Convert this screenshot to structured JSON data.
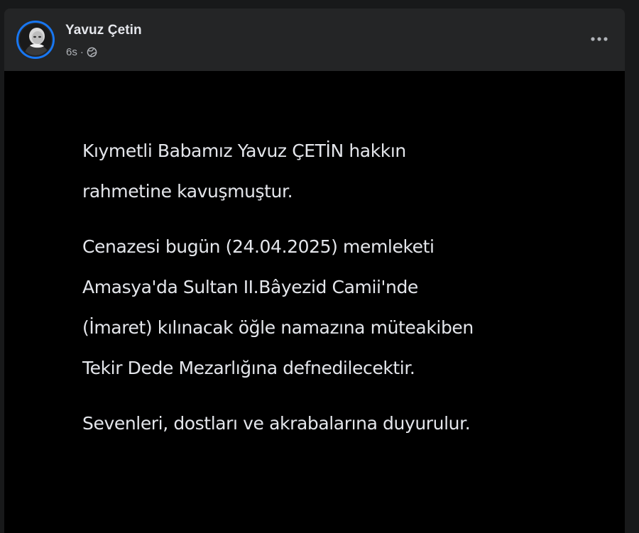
{
  "post": {
    "author": "Yavuz Çetin",
    "time": "6s",
    "separator": "·",
    "audience_icon": "globe-icon",
    "menu_icon": "more-options-icon",
    "menu_label": "•••"
  },
  "image_text": {
    "paragraph1": [
      "Kıymetli Babamız Yavuz ÇETİN hakkın",
      "rahmetine kavuşmuştur."
    ],
    "paragraph2": [
      "Cenazesi bugün (24.04.2025) memleketi",
      "Amasya'da Sultan II.Bâyezid Camii'nde",
      "(İmaret) kılınacak öğle namazına müteakiben",
      "Tekir Dede Mezarlığına defnedilecektir."
    ],
    "paragraph3": [
      "Sevenleri, dostları ve akrabalarına duyurulur."
    ]
  },
  "colors": {
    "background": "#18191a",
    "card": "#242526",
    "image_bg": "#000000",
    "primary_text": "#e4e6eb",
    "secondary_text": "#b0b3b8",
    "avatar_ring": "#1877f2"
  }
}
